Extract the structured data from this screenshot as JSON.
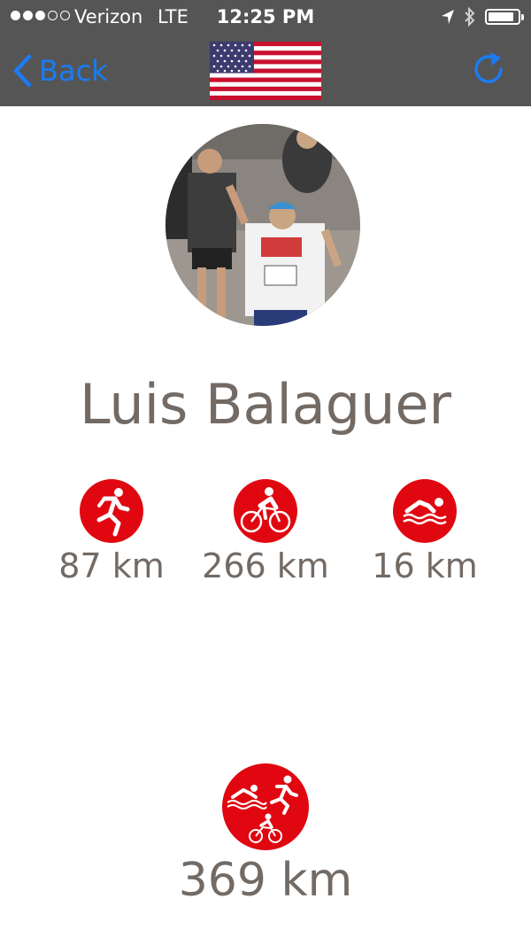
{
  "status_bar": {
    "carrier": "Verizon",
    "network": "LTE",
    "time": "12:25 PM",
    "signal_bars_filled": 3,
    "signal_bars_total": 5
  },
  "nav": {
    "back_label": "Back",
    "flag": "us-flag",
    "accent_color": "#1a7cf5"
  },
  "profile": {
    "name": "Luis Balaguer"
  },
  "stats": {
    "run": {
      "icon": "running-icon",
      "distance": "87 km"
    },
    "bike": {
      "icon": "cycling-icon",
      "distance": "266 km"
    },
    "swim": {
      "icon": "swimming-icon",
      "distance": "16 km"
    },
    "total": {
      "icon": "triathlon-icon",
      "distance": "369 km"
    }
  },
  "colors": {
    "badge_red": "#e00710",
    "text_gray": "#736a64",
    "bar_gray": "#555555"
  }
}
